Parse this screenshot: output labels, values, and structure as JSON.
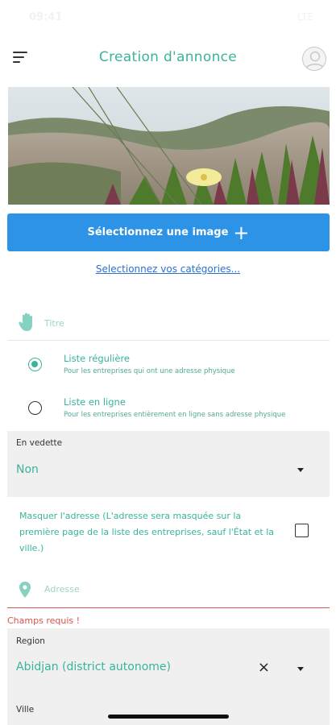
{
  "status_bar": {
    "time": "09:41",
    "indicators": "LTE"
  },
  "header": {
    "menu_icon": "menu-icon",
    "title": "Creation d'annonce",
    "avatar_icon": "user-avatar-icon"
  },
  "image_button": {
    "label": "Sélectionnez une image",
    "icon": "+"
  },
  "categories_link": "Selectionnez vos catégories...",
  "title_field": {
    "placeholder": "Titre",
    "icon": "hand-icon"
  },
  "listing_type": {
    "options": [
      {
        "label": "Liste régulière",
        "description": "Pour les entreprises qui ont une adresse physique",
        "selected": true
      },
      {
        "label": "Liste en ligne",
        "description": "Pour les entreprises entièrement en ligne sans adresse physique",
        "selected": false
      }
    ]
  },
  "featured": {
    "label": "En vedette",
    "value": "Non"
  },
  "hide_address": {
    "text": "Masquer l'adresse (L'adresse sera masquée sur la première page de la liste des entreprises, sauf l'État et la ville.)",
    "checked": false
  },
  "address_field": {
    "placeholder": "Adresse",
    "icon": "location-pin-icon"
  },
  "error": {
    "message": "Champs requis !"
  },
  "region": {
    "label": "Region",
    "value": "Abidjan (district autonome)",
    "clear_icon": "×"
  },
  "city": {
    "label": "Ville"
  },
  "colors": {
    "accent": "#3ab39c",
    "primary_button": "#2c93e6",
    "error": "#d9534f",
    "link": "#2c6fd3"
  }
}
